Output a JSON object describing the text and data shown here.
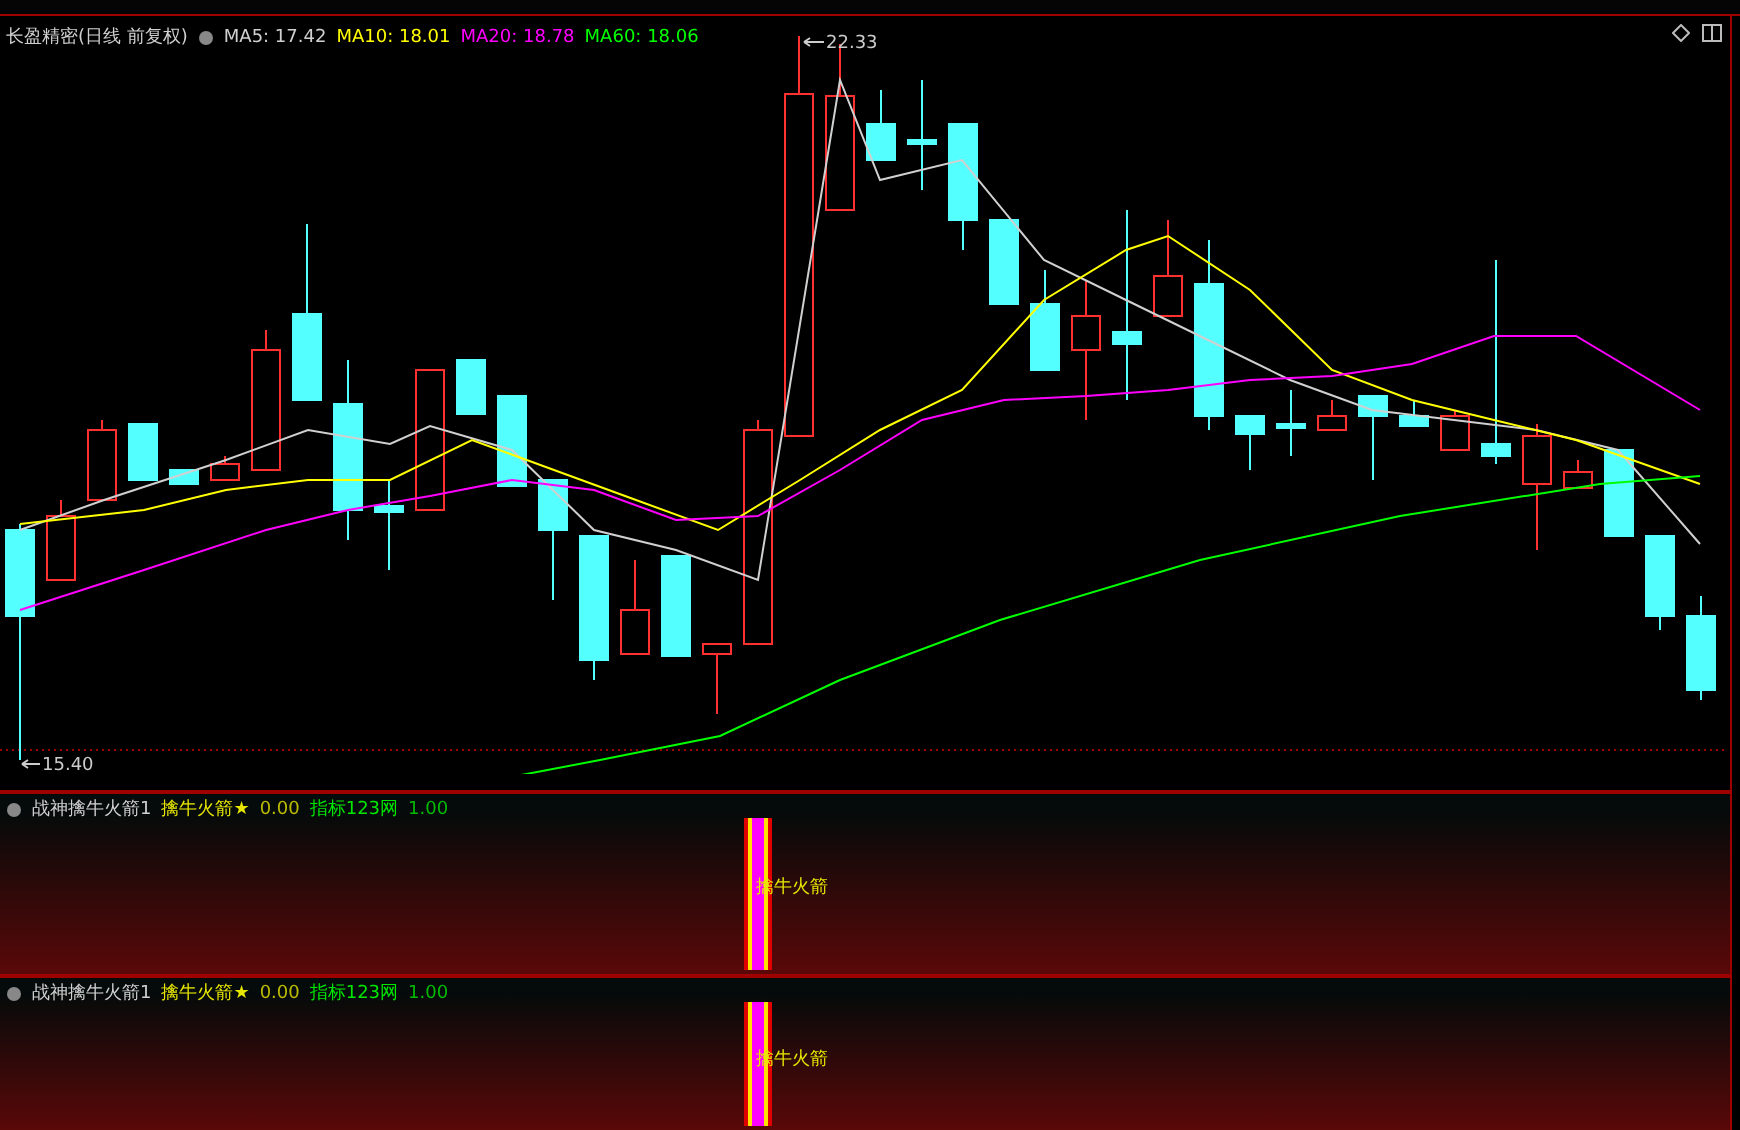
{
  "chart": {
    "title": "长盈精密(日线 前复权)",
    "averages": [
      {
        "label": "MA5: 17.42",
        "color": "#d0d0d0"
      },
      {
        "label": "MA10: 18.01",
        "color": "#ffff00"
      },
      {
        "label": "MA20: 18.78",
        "color": "#ff00ff"
      },
      {
        "label": "MA60: 18.06",
        "color": "#00ff00"
      }
    ],
    "high_label": "22.33",
    "low_label": "15.40"
  },
  "panels": [
    {
      "name": "战神擒牛火箭1",
      "legend": [
        {
          "label": "擒牛火箭★",
          "value": "0.00",
          "color": "#e6e600"
        },
        {
          "label": "指标123网",
          "value": "1.00",
          "color": "#00e600"
        }
      ],
      "signal": "擒牛火箭"
    },
    {
      "name": "战神擒牛火箭1",
      "legend": [
        {
          "label": "擒牛火箭★",
          "value": "0.00",
          "color": "#e6e600"
        },
        {
          "label": "指标123网",
          "value": "1.00",
          "color": "#00e600"
        }
      ],
      "signal": "擒牛火箭"
    }
  ]
}
